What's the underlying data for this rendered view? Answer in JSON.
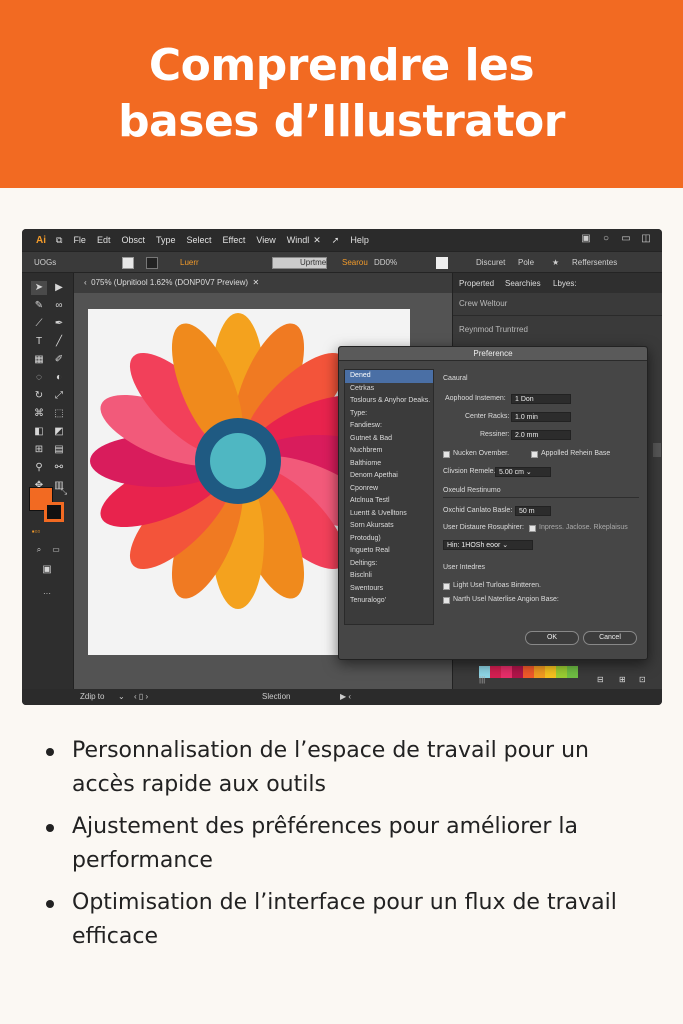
{
  "banner": {
    "title_line1": "Comprendre les",
    "title_line2": "bases d’Illustrator",
    "color": "#f26a22"
  },
  "menubar": {
    "logo": "Ai",
    "items": [
      "Fle",
      "Edt",
      "Obsct",
      "Type",
      "Select",
      "Effect",
      "View",
      "Windl",
      "Help"
    ]
  },
  "control_bar": {
    "label1": "UOGs",
    "label2": "Luerr",
    "label3": "Uprtmel",
    "label4": "Searou",
    "label5": "DD0%",
    "label6": "Discuret",
    "label7": "Pole",
    "label8": "Reffersentes"
  },
  "doc_tab": {
    "title": "075% (Upnitiool 1.62% (DONP0V7 Preview)"
  },
  "status_bar": {
    "zoom": "Zdip to",
    "mode": "Slection"
  },
  "right_panel": {
    "tabs": [
      "Properted",
      "Searchies",
      "Lbyes:"
    ],
    "line1": "Crew Weltour",
    "line2": "Reynmod Truntrred"
  },
  "dialog": {
    "title": "Preference",
    "categories": [
      "Dened",
      "Cetrkas",
      "Toslours & Anyhor Deaks.",
      "Type:",
      "Fandiesw:",
      "Gutnet & Bad",
      "Nuchbrem",
      "Balthiome",
      "Denom Apethai",
      "Cponrew",
      "Atclnua Testl",
      "Luentt & Uvelltons",
      "Sorn Akursats",
      "Protodug)",
      "Ingueto Real",
      "Deltings:",
      "Bisclnli",
      "Swentours",
      "Tenuralogo'"
    ],
    "section1": "Caaural",
    "keyboard_increment_label": "Aophood Instemen:",
    "keyboard_increment_value": "1 Don",
    "center_racks_label": "Center Racks:",
    "center_racks_value": "1.0 min",
    "ressiner_label": "Ressiner:",
    "ressiner_value": "2.0 mm",
    "check1": "Nucken Ovember.",
    "check2": "Appolled Rehein Base",
    "clivsion_label": "Clivsion Remele.",
    "clivsion_value": "5.00 cm",
    "section2": "Oxeuld Restinumo",
    "oxchid_label": "Oxchid Canlato Basle:",
    "oxchid_value": "50 m",
    "user_dist_label": "User Distaure Rosuphirer:",
    "user_dist_check": "Inpress. Jaclose. Rkeplaisus",
    "hin_label": "Hin: 1HOSh eoor",
    "section3": "User Intedres",
    "check3": "Light Usel Turloas Bintteren.",
    "check4": "Narth Usel Naterlise Angion Base:",
    "ok": "OK",
    "cancel": "Cancel"
  },
  "artwork": {
    "petal_colors": [
      "#f4a21e",
      "#f07a22",
      "#f3543a",
      "#e8234d",
      "#d91c5c",
      "#f25a7a",
      "#f2405a",
      "#f08a1c"
    ],
    "ring_color": "#1f5a82",
    "center_color": "#4fb7c2"
  },
  "swatch_colors": [
    "#8fd7e8",
    "#d61f52",
    "#e82e6a",
    "#b0154a",
    "#f25a2a",
    "#f29b21",
    "#f6c21f",
    "#9acd32",
    "#6fbf44"
  ],
  "fill_color": "#f26a22",
  "bullets": [
    "Personnalisation de l’espace de travail pour un accès rapide aux outils",
    "Ajustement des prêférences pour améliorer la performance",
    "Optimisation de l’interface pour un flux de travail efficace"
  ]
}
